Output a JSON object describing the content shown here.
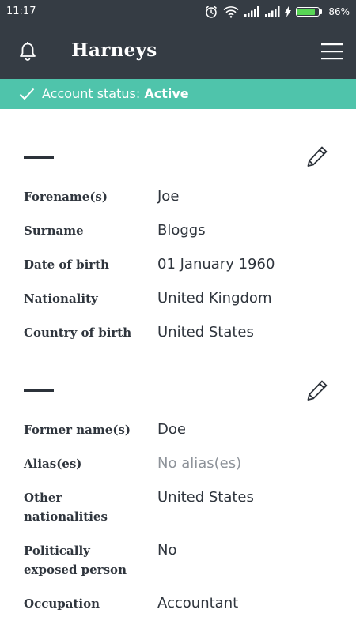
{
  "status_bar": {
    "time": "11:17",
    "battery_percent": "86%",
    "battery_level": 0.86,
    "icons": [
      "alarm-icon",
      "wifi-icon",
      "signal-icon",
      "signal-icon",
      "charging-icon",
      "battery-icon"
    ]
  },
  "app_bar": {
    "title": "Harneys",
    "left_icon": "bell-icon",
    "right_icon": "menu-icon"
  },
  "banner": {
    "prefix": "Account status: ",
    "status": "Active",
    "icon": "check-icon",
    "color": "#4fc4ab"
  },
  "section1": {
    "fields": [
      {
        "label": "Forename(s)",
        "value": "Joe"
      },
      {
        "label": "Surname",
        "value": "Bloggs"
      },
      {
        "label": "Date of birth",
        "value": "01 January 1960"
      },
      {
        "label": "Nationality",
        "value": "United Kingdom"
      },
      {
        "label": "Country of birth",
        "value": "United States"
      }
    ]
  },
  "section2": {
    "fields": [
      {
        "label": "Former name(s)",
        "value": "Doe"
      },
      {
        "label": "Alias(es)",
        "value": "No alias(es)"
      },
      {
        "label": "Other nationalities",
        "value": "United States"
      },
      {
        "label": "Politically exposed person",
        "value": "No"
      },
      {
        "label": "Occupation",
        "value": "Accountant"
      }
    ]
  },
  "colors": {
    "header": "#353c44",
    "accent": "#4fc4ab",
    "text": "#2f353d",
    "muted": "#8e939a"
  }
}
